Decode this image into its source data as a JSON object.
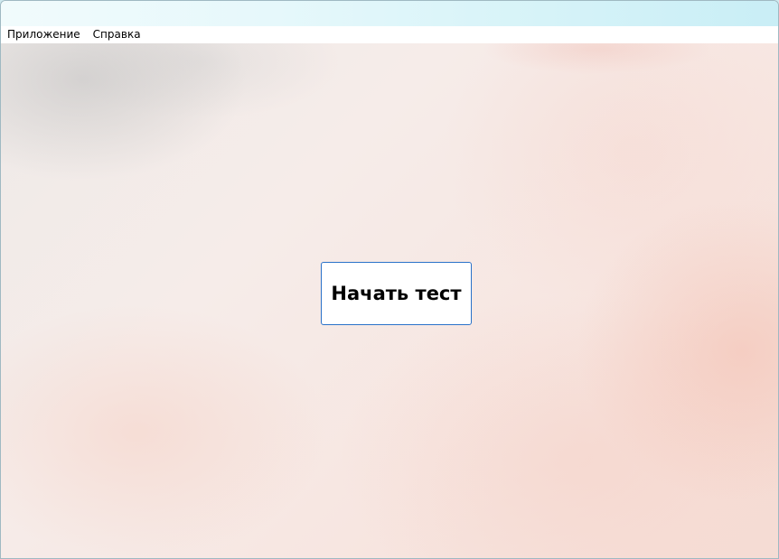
{
  "menubar": {
    "items": [
      {
        "label": "Приложение"
      },
      {
        "label": "Справка"
      }
    ]
  },
  "main": {
    "start_button_label": "Начать тест"
  },
  "colors": {
    "button_border": "#2a72c9",
    "menubar_background": "#ffffff",
    "content_background": "#f6ece8"
  }
}
